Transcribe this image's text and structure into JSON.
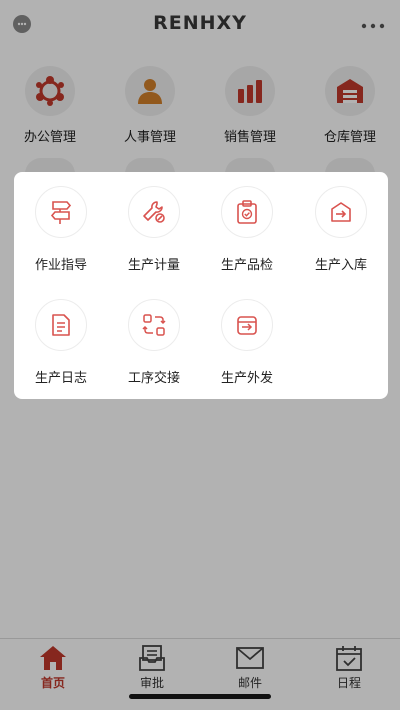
{
  "app": {
    "title": "RENHXY"
  },
  "colors": {
    "accent": "#c0392b",
    "module_icon": "#c0392b",
    "hr_icon": "#d2802a",
    "overlay": "rgba(0,0,0,0.30)"
  },
  "modules": [
    {
      "label": "办公管理",
      "icon": "office-network-icon"
    },
    {
      "label": "人事管理",
      "icon": "person-icon"
    },
    {
      "label": "销售管理",
      "icon": "bar-chart-icon"
    },
    {
      "label": "仓库管理",
      "icon": "warehouse-icon"
    }
  ],
  "popup": {
    "items": [
      {
        "label": "作业指导",
        "icon": "signpost-icon"
      },
      {
        "label": "生产计量",
        "icon": "wrench-icon"
      },
      {
        "label": "生产品检",
        "icon": "clipboard-check-icon"
      },
      {
        "label": "生产入库",
        "icon": "box-inbound-icon"
      },
      {
        "label": "生产日志",
        "icon": "document-icon"
      },
      {
        "label": "工序交接",
        "icon": "exchange-icon"
      },
      {
        "label": "生产外发",
        "icon": "outbound-box-icon"
      }
    ]
  },
  "tabbar": {
    "tabs": [
      {
        "label": "首页",
        "icon": "home-icon",
        "active": true
      },
      {
        "label": "审批",
        "icon": "inbox-icon",
        "active": false
      },
      {
        "label": "邮件",
        "icon": "mail-icon",
        "active": false
      },
      {
        "label": "日程",
        "icon": "calendar-check-icon",
        "active": false
      }
    ]
  }
}
